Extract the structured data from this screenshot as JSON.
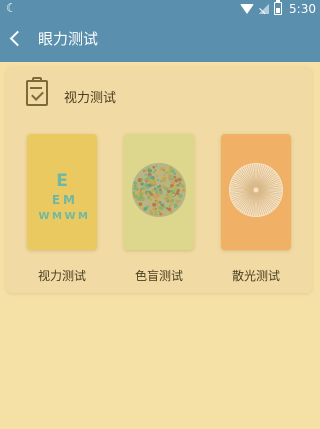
{
  "status_bar": {
    "time": "5:30",
    "icons": [
      "moon-icon",
      "wifi-icon",
      "signal-icon",
      "battery-icon"
    ],
    "color": "#5b8fae"
  },
  "app_bar": {
    "title": "眼力测试",
    "back_icon": "chevron-left-icon"
  },
  "section": {
    "title": "视力测试",
    "icon": "clipboard-check-icon"
  },
  "tests": [
    {
      "label": "视力测试",
      "color": "#e9c960",
      "icon": "eye-chart-icon",
      "chart_letters": [
        "E",
        "E",
        "M",
        "W",
        "M",
        "W",
        "M"
      ]
    },
    {
      "label": "色盲测试",
      "color": "#dcd78c",
      "icon": "color-dot-plate-icon"
    },
    {
      "label": "散光测试",
      "color": "#f0b166",
      "icon": "astigmatism-dial-icon"
    }
  ]
}
